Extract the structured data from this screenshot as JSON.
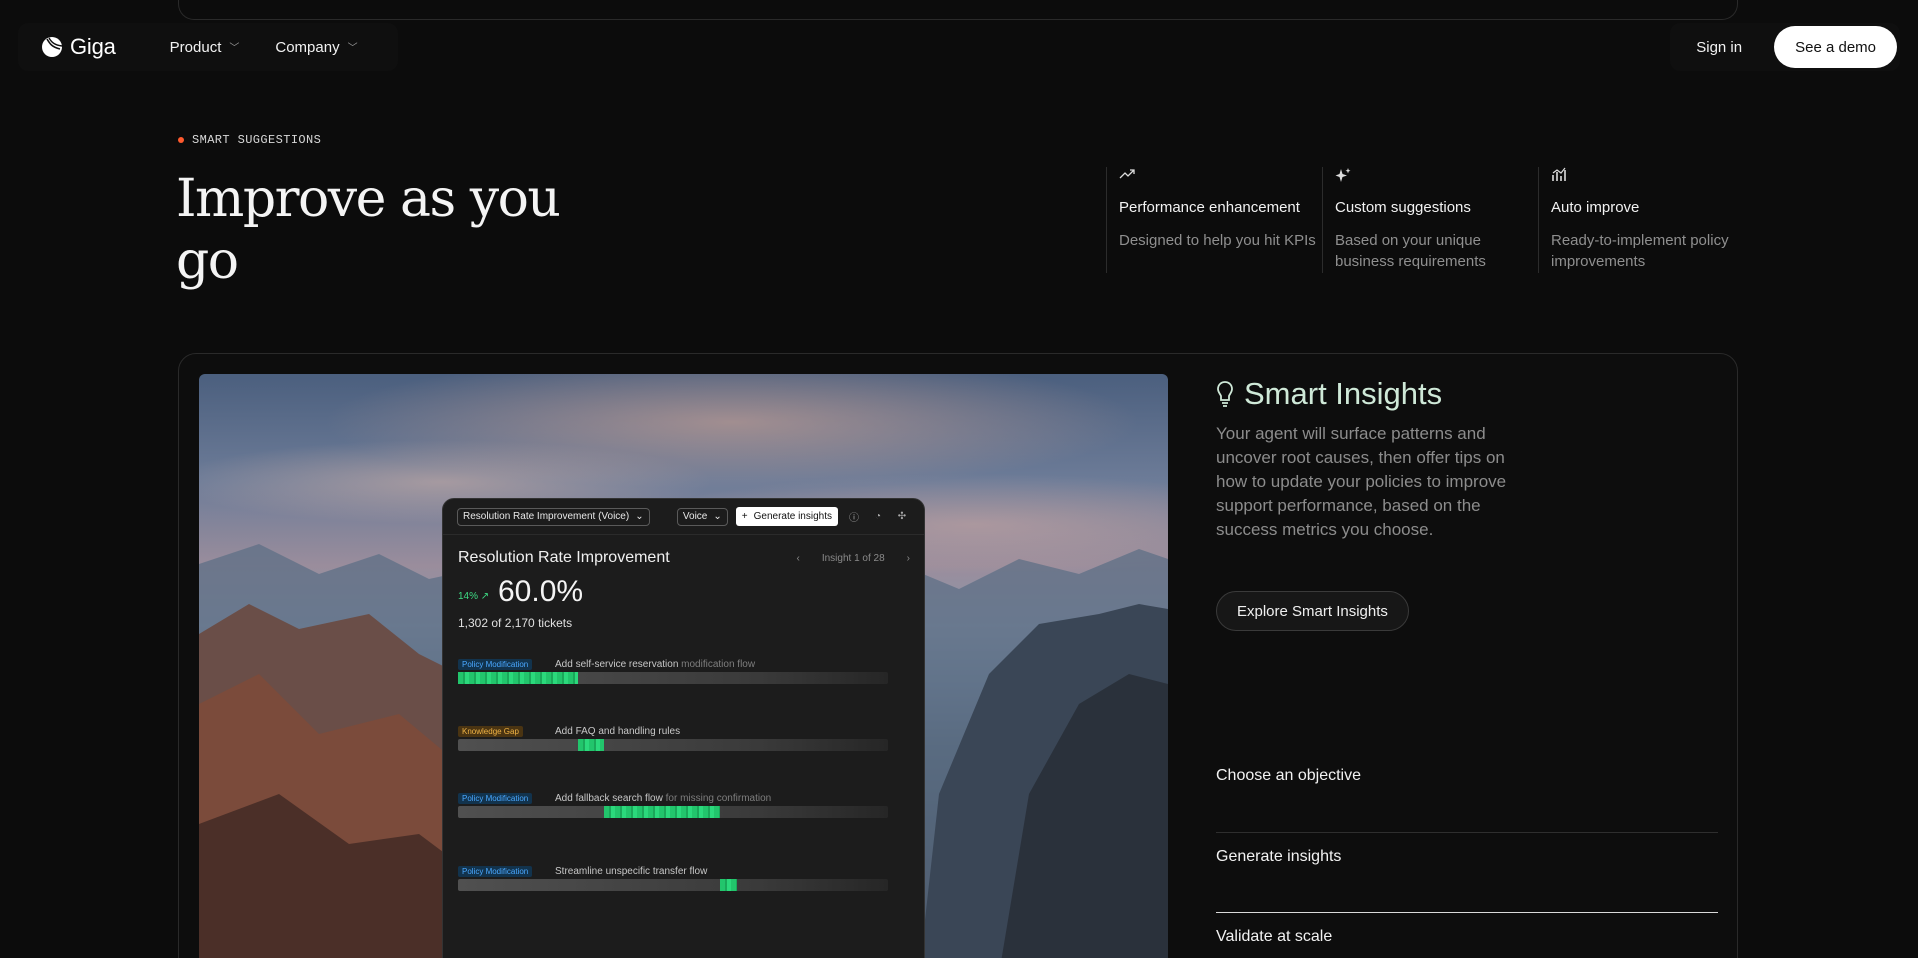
{
  "nav": {
    "logo_text": "Giga",
    "product_label": "Product",
    "company_label": "Company",
    "sign_in_label": "Sign in",
    "demo_label": "See a demo"
  },
  "hero": {
    "eyebrow": "SMART SUGGESTIONS",
    "headline": "Improve as you go"
  },
  "features": [
    {
      "icon": "trend-up-icon",
      "title": "Performance enhancement",
      "desc": "Designed to help you hit KPIs"
    },
    {
      "icon": "sparkle-icon",
      "title": "Custom suggestions",
      "desc": "Based on your unique business requirements"
    },
    {
      "icon": "chart-icon",
      "title": "Auto improve",
      "desc": "Ready-to-implement policy improvements"
    }
  ],
  "app": {
    "objective_select": "Resolution Rate Improvement (Voice)",
    "channel_select": "Voice",
    "generate_label": "Generate insights",
    "title": "Resolution Rate Improvement",
    "pager": "Insight 1 of 28",
    "delta": "14%",
    "value": "60.0%",
    "tickets": "1,302 of 2,170 tickets",
    "rows": [
      {
        "tag": "Policy Modification",
        "label": "Add self-service reservation",
        "label_muted": " modification flow",
        "fill_start": 0.0,
        "fill_end": 0.28
      },
      {
        "tag": "Knowledge Gap",
        "label": "Add FAQ and handling rules",
        "label_muted": "",
        "fill_start": 0.28,
        "fill_end": 0.34
      },
      {
        "tag": "Policy Modification",
        "label": "Add fallback search flow",
        "label_muted": " for missing confirmation",
        "fill_start": 0.34,
        "fill_end": 0.61
      },
      {
        "tag": "Policy Modification",
        "label": "Streamline unspecific transfer flow",
        "label_muted": "",
        "fill_start": 0.61,
        "fill_end": 0.65
      }
    ]
  },
  "insights": {
    "title": "Smart Insights",
    "desc": "Your agent will surface patterns and uncover root causes, then offer tips on how to update your policies to improve support performance, based on the success metrics you choose.",
    "button": "Explore Smart Insights"
  },
  "steps": [
    "Choose an objective",
    "Generate insights",
    "Validate at scale"
  ],
  "colors": {
    "accent_dot": "#ff5a2e",
    "green": "#22c56c",
    "insight_title": "#cfe9d8"
  }
}
